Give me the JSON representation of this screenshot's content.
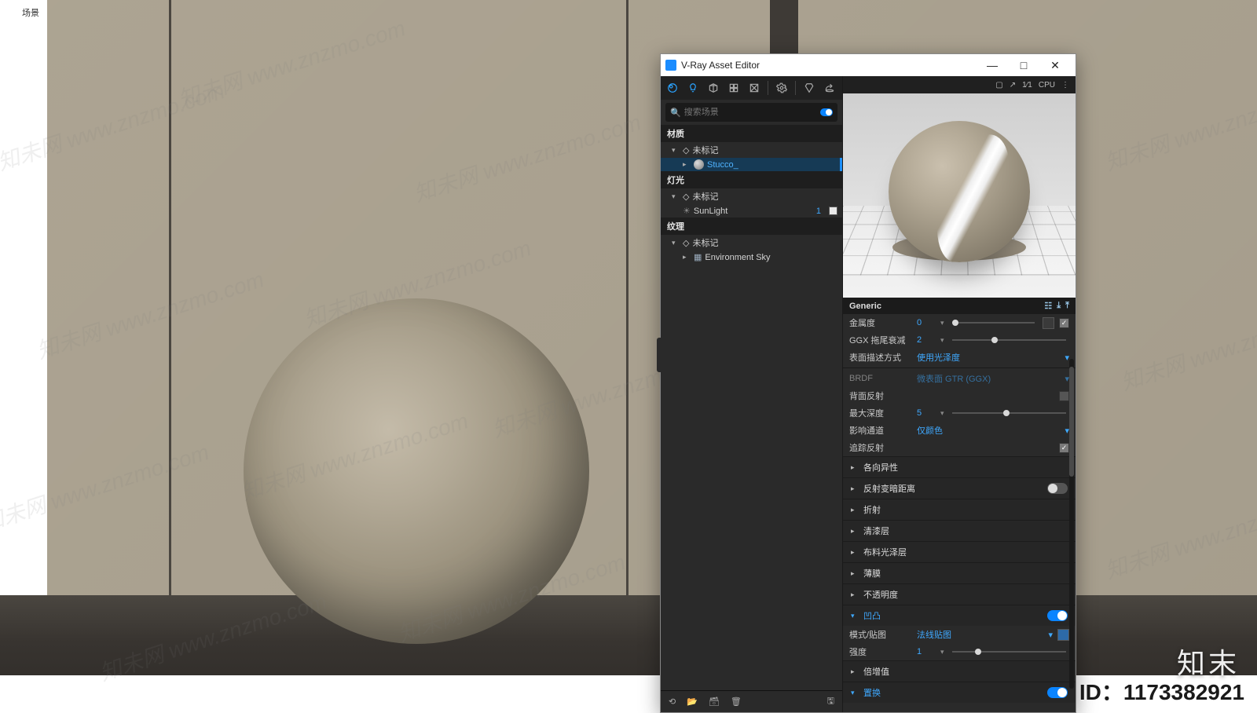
{
  "host_menu": "场景",
  "id_label": "ID：1173382921",
  "logo_text": "知末",
  "watermark": "知未网 www.znzmo.com",
  "window": {
    "title": "V-Ray Asset Editor",
    "min": "—",
    "max": "□",
    "close": "✕"
  },
  "tabs": {
    "materials": "材质",
    "lights": "灯光",
    "geometry": "几何体",
    "render": "渲染元素",
    "settings": "设置",
    "frame": "帧缓冲",
    "render_out": "渲染"
  },
  "search": {
    "placeholder": "搜索场景"
  },
  "tree": {
    "materials_hdr": "材质",
    "untagged": "未标记",
    "stucco": "Stucco_",
    "lights_hdr": "灯光",
    "sunlight": "SunLight",
    "sunlight_count": "1",
    "textures_hdr": "纹理",
    "env_sky": "Environment Sky"
  },
  "preview_bar": {
    "pop": "▢",
    "nav": "↗",
    "frac": "1⁄1",
    "mode": "CPU",
    "menu": "⋮"
  },
  "section": {
    "generic": "Generic"
  },
  "props": {
    "metalness": {
      "label": "金属度",
      "value": "0"
    },
    "ggx_tail": {
      "label": "GGX 拖尾衰减",
      "value": "2"
    },
    "surf_mode": {
      "label": "表面描述方式",
      "value": "使用光泽度"
    },
    "brdf": {
      "label": "BRDF",
      "value": "微表面 GTR (GGX)"
    },
    "backface": {
      "label": "背面反射"
    },
    "max_depth": {
      "label": "最大深度",
      "value": "5"
    },
    "affect_ch": {
      "label": "影响通道",
      "value": "仅颜色"
    },
    "trace_refl": {
      "label": "追踪反射"
    }
  },
  "collapsibles": {
    "anis": "各向异性",
    "refl_dim": "反射变暗距离",
    "refr": "折射",
    "coat": "清漆层",
    "sheen": "布料光泽层",
    "film": "薄膜",
    "opacity": "不透明度",
    "bump": "凹凸",
    "mult": "倍增值",
    "last": "置换"
  },
  "bump": {
    "mode_label": "模式/贴图",
    "mode_value": "法线贴图",
    "strength_label": "强度",
    "strength_value": "1"
  },
  "bottom": {
    "home": "⌂",
    "open": "📂",
    "purge": "🗑",
    "del": "🗑",
    "save": "🖫"
  }
}
